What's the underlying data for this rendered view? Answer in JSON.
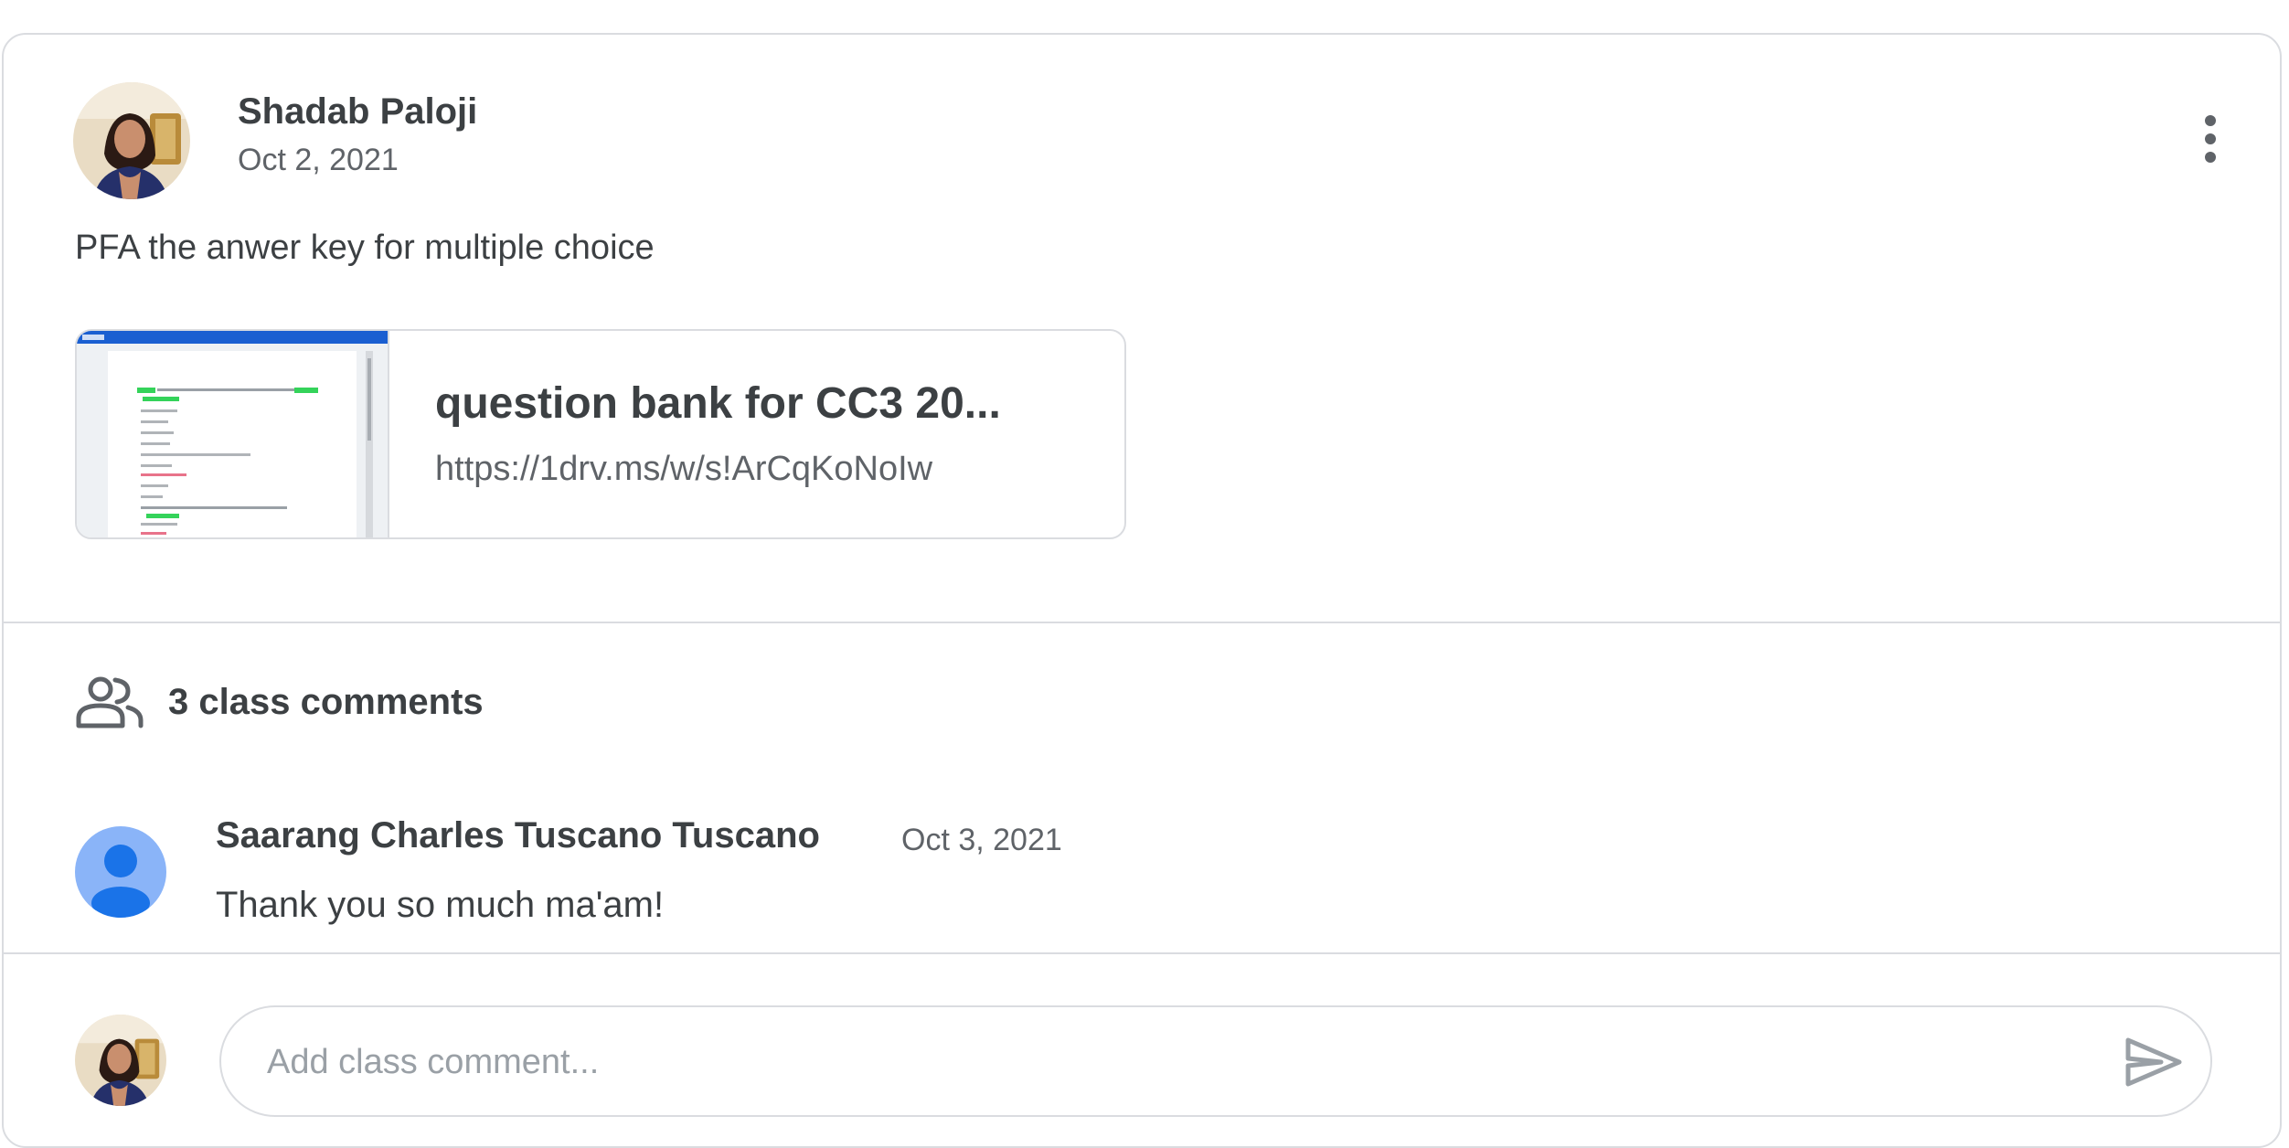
{
  "post": {
    "author": "Shadab Paloji",
    "date": "Oct 2, 2021",
    "text": "PFA the anwer key for multiple choice",
    "attachment": {
      "title": "question bank for CC3 20...",
      "url": "https://1drv.ms/w/s!ArCqKoNoIw"
    }
  },
  "comments": {
    "count_label": "3 class comments",
    "items": [
      {
        "author": "Saarang Charles Tuscano Tuscano",
        "date": "Oct 3, 2021",
        "text": "Thank you so much ma'am!"
      }
    ]
  },
  "composer": {
    "placeholder": "Add class comment..."
  },
  "colors": {
    "border": "#dadce0",
    "text_primary": "#3c4043",
    "text_secondary": "#5f6368",
    "avatar_generic_bg": "#8ab4f8",
    "avatar_generic_fg": "#1a73e8",
    "highlight_green": "#34d35a",
    "doc_header_blue": "#1a5fd1"
  },
  "icons": {
    "more": "more-vert-icon",
    "comments": "people-icon",
    "send": "send-icon"
  }
}
